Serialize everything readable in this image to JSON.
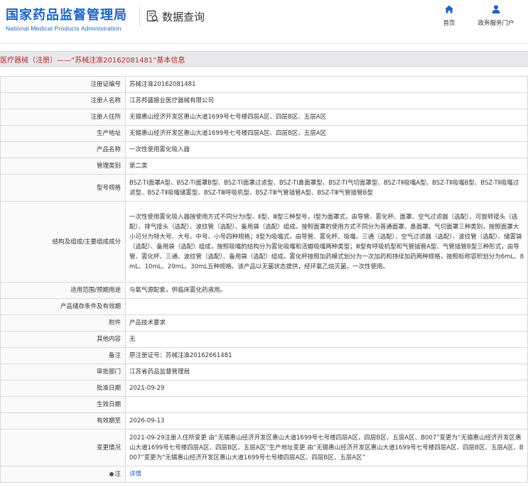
{
  "header": {
    "logo_cn": "国家药品监督管理局",
    "logo_en": "National Medical Products Administration",
    "section_title": "数据查询",
    "section_icon": "search-document-icon",
    "nav": [
      {
        "label": "首页",
        "icon": "home-icon"
      },
      {
        "label": "政务服务门户",
        "icon": "user-icon"
      }
    ]
  },
  "title_bar": {
    "text": "医疗器械（注册）——“苏械注准20162081481”基本信息"
  },
  "colors": {
    "brand_blue": "#1c63c3",
    "title_red": "#b32c22",
    "border": "#d9d9d9"
  },
  "rows": [
    {
      "label": "注册证编号",
      "value": "苏械注准20162081481"
    },
    {
      "label": "注册人名称",
      "value": "江苏邦盛振业医疗器械有限公司"
    },
    {
      "label": "注册人住所",
      "value": "无锡惠山经济开发区惠山大道1699号七号楼四层A区、四层B区、五层A区"
    },
    {
      "label": "生产地址",
      "value": "无锡惠山经济开发区惠山大道1699号七号楼四层A区、四层B区、五层A区"
    },
    {
      "label": "产品名称",
      "value": "一次性使用雾化吸入器"
    },
    {
      "label": "管理类别",
      "value": "第二类"
    },
    {
      "label": "型号规格",
      "value": "BSZ-TⅠ面罩A型、BSZ-TⅠ面罩B型、BSZ-TⅠ面罩过滤型、BSZ-TⅠ鼻面罩型、BSZ-TⅠ气切面罩型、BSZ-TⅡ吸嘴A型、BSZ-TⅡ吸嘴B型、BSZ-TⅡ吸嘴过滤型、BSZ-TⅡ吸嘴储雾型、BSZ-TⅢ呼吸机型、BSZ-TⅢ气管插管A型、BSZ-TⅢ气管插管B型"
    },
    {
      "label": "结构及组成/主要组成成分",
      "value": "一次性使用雾化吸入器按使用方式不同分为Ⅰ型、Ⅱ型、Ⅲ型三种型号，Ⅰ型为面罩式，由导管、雾化杯、面罩、空气过滤器（选配）、可旋转接头（选配）、排气接头（选配）、波纹管（选配）、备用袋（选配）组成。按照面罩的使用方式不同分为普通面罩、鼻面罩、气切面罩三种类别，按照面罩大小可分为特大号、大号、中号、小号四种规格；Ⅱ型为吸嘴式，由导管、雾化杯、吸嘴、三通（选配）、空气过滤器（选配）、波纹管（选配）、储雾袋（选配）、备用袋（选配）组成，按照吸嘴的结构分为雾化吸嘴和活瓣吸嘴两种类型；Ⅲ型有呼吸机型和气管插管A型、气管插管B型三种形式，由导管、雾化杯、三通、波纹管（选配）、备用袋（选配）组成。雾化杯按照加药模式划分为一次加药和持续加药两种规格，按照标称容积划分为6mL、8mL、10mL、20mL、30mL五种规格。该产品以无菌状态提供，经环氧乙烷灭菌，一次性使用。"
    },
    {
      "label": "适用范围/预期用途",
      "value": "与氧气源配套，供临床雾化药液用。"
    },
    {
      "label": "产品储存条件及有效期",
      "value": ""
    },
    {
      "label": "附件",
      "value": "产品技术要求"
    },
    {
      "label": "其他内容",
      "value": "无"
    },
    {
      "label": "备注",
      "value": "原注册证号：苏械注准20162661481"
    },
    {
      "label": "审批部门",
      "value": "江苏省药品监督管理局"
    },
    {
      "label": "批准日期",
      "value": "2021-09-29"
    },
    {
      "label": "生效日期",
      "value": ""
    },
    {
      "label": "有效期至",
      "value": "2026-09-13"
    },
    {
      "label": "变更情况",
      "value": "2021-09-29注册人住所变更 由“无锡惠山经济开发区惠山大道1699号七号楼四层A区、四层B区、五层A区、B007”变更为“无锡惠山经济开发区惠山大道1699号七号楼四层A区、四层B区、五层A区”生产地址变更 由“无锡惠山经济开发区惠山大道1699号七号楼四层A区、四层B区、五层A区、B007”变更为“无锡惠山经济开发区惠山大道1699号七号楼四层A区、四层B区、五层A区”"
    }
  ],
  "note": {
    "label": "注",
    "link_text": "详情"
  }
}
